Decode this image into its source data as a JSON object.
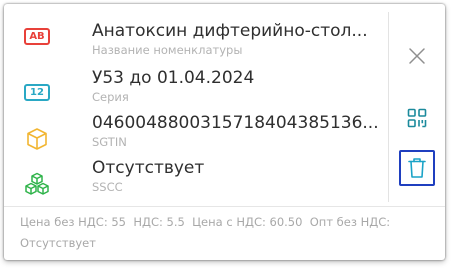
{
  "product": {
    "name": "Анатоксин дифтерийно-стол...",
    "name_label": "Название номенклатуры",
    "name_badge": "AB",
    "series": "У53 до 01.04.2024",
    "series_label": "Серия",
    "series_badge": "12",
    "sgtin": "0460048800315718404385136...",
    "sgtin_label": "SGTIN",
    "sscc": "Отсутствует",
    "sscc_label": "SSCC"
  },
  "footer": {
    "price_no_vat": "Цена без НДС: 55",
    "vat": "НДС: 5.5",
    "price_with_vat": "Цена с НДС: 60.50",
    "wholesale_no_vat": "Опт без НДС: Отсутствует"
  },
  "icons": {
    "name": "ab-badge-icon",
    "series": "number-badge-icon",
    "sgtin": "box-icon",
    "sscc": "boxes-icon",
    "close": "close-icon",
    "qr": "qr-code-icon",
    "delete": "trash-icon"
  },
  "colors": {
    "name_badge": "#e8413a",
    "series_badge": "#2aa8c4",
    "box": "#f2b632",
    "boxes": "#2fb34a",
    "qr": "#1b8a9c",
    "trash": "#1aa3c7",
    "focus_border": "#1f3fbf"
  }
}
